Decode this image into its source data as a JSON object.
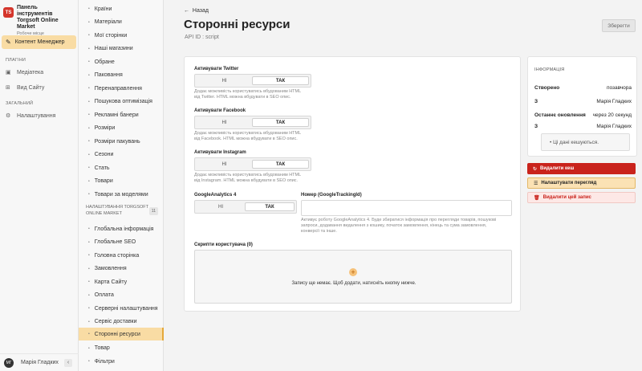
{
  "app": {
    "title_line1": "Панель інструментів",
    "title_line2": "Torgsoft Online Market",
    "subtitle": "Робоче місце",
    "logo_text": "TS",
    "accent": "#f9dca4"
  },
  "nav": {
    "main_item": "Контент Менеджер",
    "plugins_label": "ПЛАГІНИ",
    "plugins": [
      "Медіатека",
      "Вид Сайту"
    ],
    "general_label": "ЗАГАЛЬНИЙ",
    "general": [
      "Налаштування"
    ]
  },
  "user": {
    "initials": "МГ",
    "name": "Марія Гладких"
  },
  "submenu": {
    "items": [
      "Країни",
      "Матеріали",
      "Мої сторінки",
      "Наші магазини",
      "Обране",
      "Паковання",
      "Перенаправлення",
      "Пошукова оптимізація",
      "Рекламні банери",
      "Розміри",
      "Розміри пакувань",
      "Сезони",
      "Стать",
      "Товари",
      "Товари за моделями"
    ],
    "group_label": "НАЛАШТУВАННЯ TORGSOFT ONLINE MARKET",
    "group_count": "11",
    "group_items": [
      "Глобальна інформація",
      "Глобальне SEO",
      "Головна сторінка",
      "Замовлення",
      "Карта Сайту",
      "Оплата",
      "Серверні налаштування",
      "Сервіс доставки",
      "Сторонні ресурси",
      "Товар",
      "Фільтри"
    ],
    "active_index": 8
  },
  "page": {
    "back": "Назад",
    "title": "Сторонні ресурси",
    "api_id": "API ID : script",
    "save": "Зберегти"
  },
  "form": {
    "toggle_no": "НІ",
    "toggle_yes": "ТАК",
    "twitter": {
      "label": "Активувати Twitter",
      "hint1": "Додає можливість користуватись вбудованим HTML",
      "hint2": "від Twitter. HTML можна вбудувати в SEO опис.",
      "value": "ТАК"
    },
    "facebook": {
      "label": "Активувати Facebook",
      "hint1": "Додає можливість користуватись вбудованим HTML",
      "hint2": "від Facebook. HTML можна вбудувати в SEO опис.",
      "value": "ТАК"
    },
    "instagram": {
      "label": "Активувати Instagram",
      "hint1": "Додає можливість користуватись вбудованим HTML",
      "hint2": "від Instagram. HTML можна вбудувати в SEO опис.",
      "value": "ТАК"
    },
    "ga": {
      "label": "GoogleAnalytics 4",
      "value": "ТАК"
    },
    "tracking": {
      "label": "Номер (GoogleTrackingId)",
      "value": "",
      "hint1": "Активує роботу GoogleAnalytics 4. Буде збиратися інформація про перегляди товарів, пошукові",
      "hint2": "запроси, додавання видалення з кошику, початок замовлення, кінець та сума замовлення,",
      "hint3": "конверсії та інше."
    },
    "scripts": {
      "label": "Скрипти користувача (0)",
      "empty": "Запису ще немає. Щоб додати, натисніть кнопку нижче."
    }
  },
  "info": {
    "header": "ІНФОРМАЦІЯ",
    "created_label": "Створено",
    "created_value": "позавчора",
    "created_by_label": "З",
    "created_by": "Марія Гладких",
    "updated_label": "Останнє оновлення",
    "updated_value": "через 20 секунд",
    "updated_by_label": "З",
    "updated_by": "Марія Гладких",
    "cache_note": "Ці дані кешуються."
  },
  "actions": {
    "delete_cache": "Видалити кеш",
    "configure_view": "Налаштувати перегляд",
    "delete_record": "Видалити цей запис"
  }
}
